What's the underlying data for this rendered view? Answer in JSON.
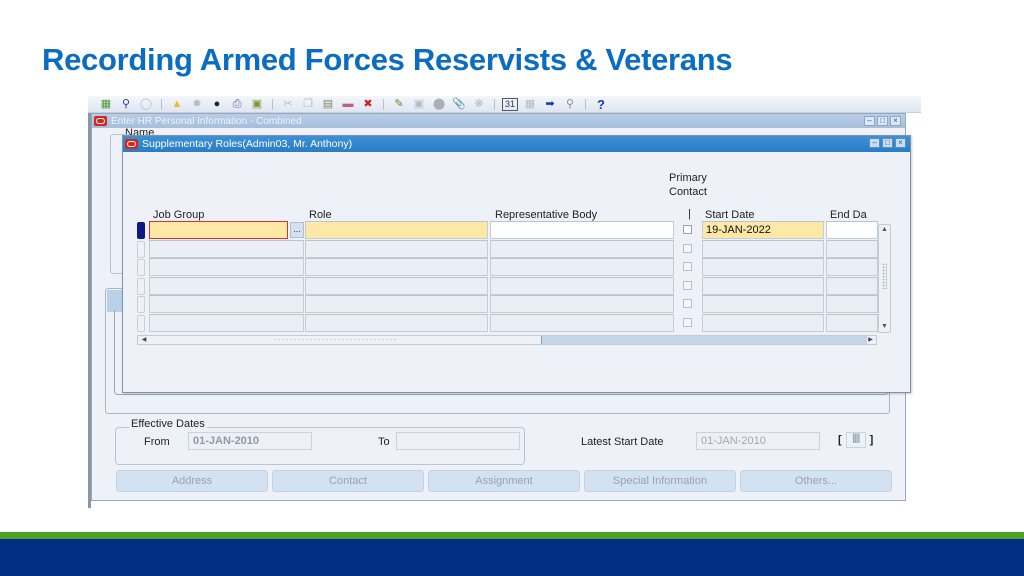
{
  "slide": {
    "title": "Recording Armed Forces Reservists & Veterans",
    "colors": {
      "title": "#0a6dc2",
      "footer_green": "#4ea325",
      "footer_blue": "#002e85"
    }
  },
  "toolbar": {
    "icons": [
      "new-record-icon",
      "find-flashlight-icon",
      "show-navigator-icon",
      "sep",
      "save-folder-icon",
      "next-step-icon",
      "switch-responsibility-icon",
      "print-icon",
      "close-form-icon",
      "sep",
      "cut-icon",
      "copy-icon",
      "paste-icon",
      "clear-record-icon",
      "delete-record-icon",
      "sep",
      "edit-field-icon",
      "zoom-icon",
      "translations-icon",
      "attachments-icon",
      "folder-tools-icon",
      "sep",
      "calendar-icon",
      "list-icon",
      "export-icon",
      "search-icon",
      "sep",
      "help-icon"
    ],
    "help_glyph": "?"
  },
  "parent_window": {
    "title": "Enter HR Personal Information - Combined",
    "name_label": "Name",
    "effective_dates": {
      "legend": "Effective Dates",
      "from_label": "From",
      "from_value": "01-JAN-2010",
      "to_label": "To",
      "to_value": ""
    },
    "latest_start_date": {
      "label": "Latest Start Date",
      "value": "01-JAN-2010"
    },
    "flexfield": {
      "open": "[",
      "value": "||||",
      "close": "]"
    },
    "buttons": [
      "Address",
      "Contact",
      "Assignment",
      "Special Information",
      "Others..."
    ]
  },
  "child_window": {
    "title": "Supplementary Roles(Admin03, Mr. Anthony)",
    "columns": {
      "job_group": "Job Group",
      "role": "Role",
      "representative_body": "Representative Body",
      "primary_contact_line1": "Primary",
      "primary_contact_line2": "Contact",
      "primary_contact_marker": "|",
      "start_date": "Start Date",
      "end_date": "End Da"
    },
    "lov_button": "...",
    "rows": [
      {
        "job_group": "",
        "role": "",
        "representative_body": "",
        "primary_contact": false,
        "start_date": "19-JAN-2022",
        "end_date": ""
      },
      {
        "job_group": "",
        "role": "",
        "representative_body": "",
        "primary_contact": false,
        "start_date": "",
        "end_date": ""
      },
      {
        "job_group": "",
        "role": "",
        "representative_body": "",
        "primary_contact": false,
        "start_date": "",
        "end_date": ""
      },
      {
        "job_group": "",
        "role": "",
        "representative_body": "",
        "primary_contact": false,
        "start_date": "",
        "end_date": ""
      },
      {
        "job_group": "",
        "role": "",
        "representative_body": "",
        "primary_contact": false,
        "start_date": "",
        "end_date": ""
      },
      {
        "job_group": "",
        "role": "",
        "representative_body": "",
        "primary_contact": false,
        "start_date": "",
        "end_date": ""
      }
    ]
  }
}
